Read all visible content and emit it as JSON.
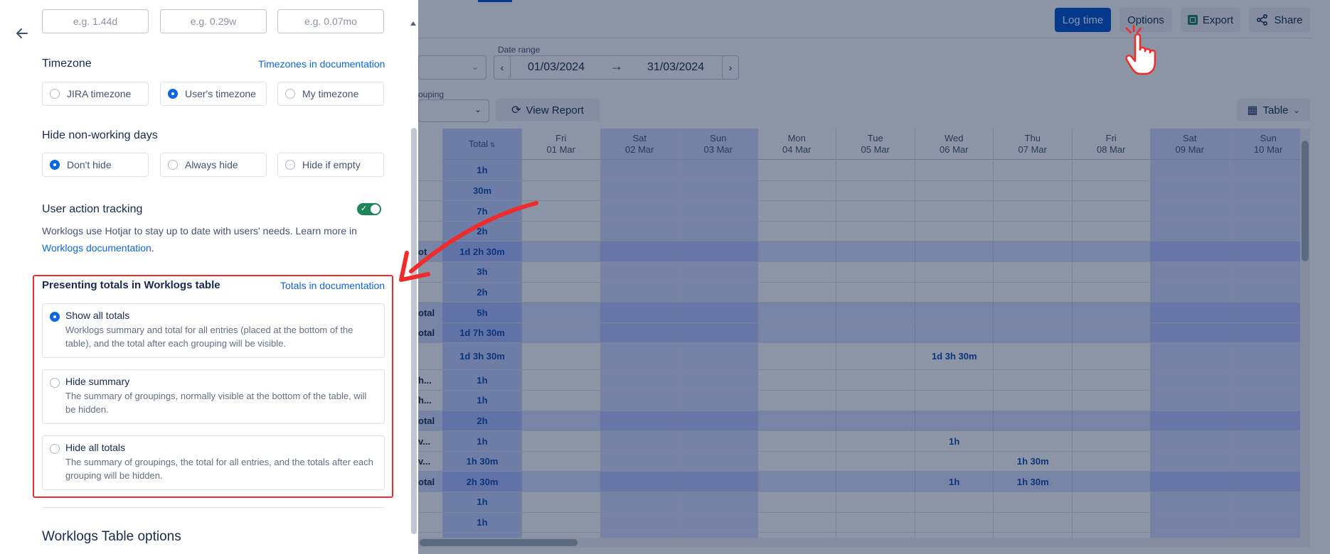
{
  "toolbar": {
    "log_time": "Log time",
    "options": "Options",
    "export": "Export",
    "share": "Share"
  },
  "filters": {
    "date_range_label": "Date range",
    "date_from": "01/03/2024",
    "date_to": "31/03/2024",
    "grouping_label": "ouping",
    "view_report": "View Report",
    "view_mode": "Table"
  },
  "grid": {
    "total_header": "Total",
    "days": [
      {
        "day": "Fri",
        "date": "01 Mar",
        "weekend": false
      },
      {
        "day": "Sat",
        "date": "02 Mar",
        "weekend": true
      },
      {
        "day": "Sun",
        "date": "03 Mar",
        "weekend": true
      },
      {
        "day": "Mon",
        "date": "04 Mar",
        "weekend": false
      },
      {
        "day": "Tue",
        "date": "05 Mar",
        "weekend": false
      },
      {
        "day": "Wed",
        "date": "06 Mar",
        "weekend": false
      },
      {
        "day": "Thu",
        "date": "07 Mar",
        "weekend": false
      },
      {
        "day": "Fri",
        "date": "08 Mar",
        "weekend": false
      },
      {
        "day": "Sat",
        "date": "09 Mar",
        "weekend": true
      },
      {
        "day": "Sun",
        "date": "10 Mar",
        "weekend": true
      }
    ],
    "rows": [
      {
        "label": "",
        "total": "1h",
        "sum": false,
        "cells": {}
      },
      {
        "label": "",
        "total": "30m",
        "sum": false,
        "cells": {}
      },
      {
        "label": "",
        "total": "7h",
        "sum": false,
        "cells": {}
      },
      {
        "label": "",
        "total": "2h",
        "sum": false,
        "cells": {}
      },
      {
        "label": "ot",
        "total": "1d 2h 30m",
        "sum": true,
        "cells": {}
      },
      {
        "label": "",
        "total": "3h",
        "sum": false,
        "cells": {}
      },
      {
        "label": "",
        "total": "2h",
        "sum": false,
        "cells": {}
      },
      {
        "label": "otal",
        "total": "5h",
        "sum": true,
        "cells": {}
      },
      {
        "label": "otal",
        "total": "1d 7h 30m",
        "sum": true,
        "cells": {}
      },
      {
        "label": "",
        "total": "1d 3h 30m",
        "sum": false,
        "tall": true,
        "cells": {
          "5": "1d 3h 30m"
        }
      },
      {
        "label": "h...",
        "total": "1h",
        "sum": false,
        "cells": {}
      },
      {
        "label": "h...",
        "total": "1h",
        "sum": false,
        "cells": {}
      },
      {
        "label": "otal",
        "total": "2h",
        "sum": true,
        "cells": {}
      },
      {
        "label": "v...",
        "total": "1h",
        "sum": false,
        "cells": {
          "5": "1h"
        }
      },
      {
        "label": "v...",
        "total": "1h 30m",
        "sum": false,
        "cells": {
          "6": "1h 30m"
        }
      },
      {
        "label": "otal",
        "total": "2h 30m",
        "sum": true,
        "cells": {
          "5": "1h",
          "6": "1h 30m"
        }
      },
      {
        "label": "",
        "total": "1h",
        "sum": false,
        "cells": {}
      },
      {
        "label": "",
        "total": "1h",
        "sum": false,
        "cells": {}
      }
    ]
  },
  "panel": {
    "placeholders": [
      "e.g. 1.44d",
      "e.g. 0.29w",
      "e.g. 0.07mo"
    ],
    "timezone": {
      "title": "Timezone",
      "link": "Timezones in documentation",
      "options": [
        {
          "label": "JIRA timezone",
          "selected": false
        },
        {
          "label": "User's timezone",
          "selected": true
        },
        {
          "label": "My timezone",
          "selected": false
        }
      ]
    },
    "nonworking": {
      "title": "Hide non-working days",
      "options": [
        {
          "label": "Don't hide",
          "selected": true
        },
        {
          "label": "Always hide",
          "selected": false
        },
        {
          "label": "Hide if empty",
          "selected": false
        }
      ]
    },
    "tracking": {
      "title": "User action tracking",
      "enabled": true,
      "desc": "Worklogs use Hotjar to stay up to date with users' needs. Learn more in",
      "link": "Worklogs documentation",
      "after_link": "."
    },
    "totals": {
      "title": "Presenting totals in Worklogs table",
      "link": "Totals in documentation",
      "options": [
        {
          "title": "Show all totals",
          "desc": "Worklogs summary and total for all entries (placed at the bottom of the table), and the total after each grouping will be visible.",
          "selected": true
        },
        {
          "title": "Hide summary",
          "desc": "The summary of groupings, normally visible at the bottom of the table, will be hidden.",
          "selected": false
        },
        {
          "title": "Hide all totals",
          "desc": "The summary of groupings, the total for all entries, and the totals after each grouping will be hidden.",
          "selected": false
        }
      ]
    },
    "table_options_title": "Worklogs Table options"
  },
  "colors": {
    "primary": "#0052cc",
    "link": "#0c66e4",
    "annotation_red": "#ef2b2b",
    "toggle_on": "#1f845a"
  }
}
